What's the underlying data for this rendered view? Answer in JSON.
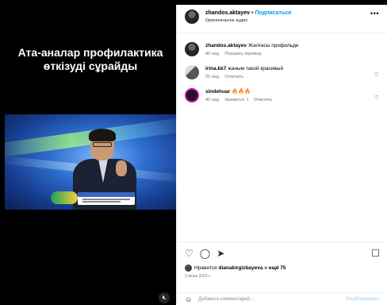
{
  "media": {
    "title_line1": "Ата-аналар профилактика",
    "title_line2": "өткізуді сұрайды",
    "mute_icon": "speaker-muted-icon"
  },
  "header": {
    "username": "zhandos.aktayev",
    "separator": "•",
    "follow_label": "Подписаться",
    "audio_label": "Оригинальное аудио",
    "more_icon": "more-icon"
  },
  "comments": [
    {
      "user": "zhandos.aktayev",
      "text": "Жалғасы профильде",
      "time": "40 нед.",
      "action": "Показать перевод"
    },
    {
      "user": "irina.kk7",
      "text": "жаным такой красивый",
      "time": "25 нед.",
      "action": "Ответить"
    },
    {
      "user": "sindehuar",
      "text": "🔥🔥🔥",
      "time": "40 нед.",
      "likes": "Нравится: 1",
      "action": "Ответить"
    }
  ],
  "footer": {
    "likes_prefix": "Нравится",
    "likes_user": "dianakirgizbayeva",
    "likes_mid": "и",
    "likes_count": "ещё 75",
    "date": "2 июнь 2023 г."
  },
  "add_comment": {
    "placeholder": "Добавьте комментарий...",
    "post_label": "Опубликовать"
  },
  "colors": {
    "accent": "#0095f6",
    "muted": "#737373"
  }
}
